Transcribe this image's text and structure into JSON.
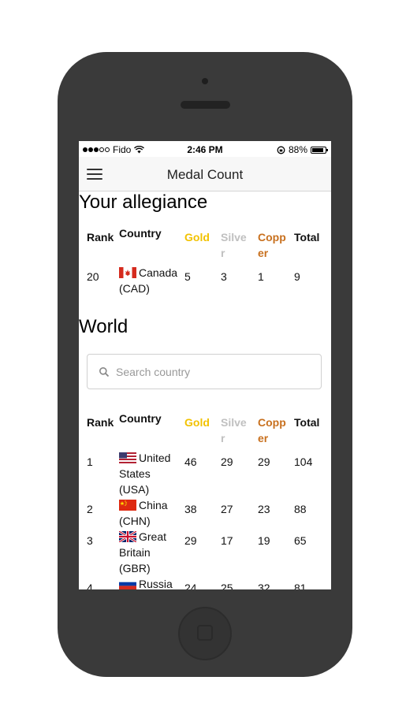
{
  "status": {
    "carrier": "Fido",
    "time": "2:46 PM",
    "battery": "88%",
    "battery_level": 0.88
  },
  "nav": {
    "title": "Medal Count",
    "menu_icon": "hamburger-icon"
  },
  "allegiance": {
    "heading": "Your allegiance",
    "columns": {
      "rank": "Rank",
      "country": "Country",
      "gold": "Gold",
      "silver": "Silver",
      "copper": "Copper",
      "total": "Total"
    },
    "row": {
      "rank": "20",
      "country": "Canada (CAD)",
      "flag": "canada-flag-icon",
      "gold": "5",
      "silver": "3",
      "copper": "1",
      "total": "9"
    }
  },
  "world": {
    "heading": "World",
    "search_placeholder": "Search country",
    "columns": {
      "rank": "Rank",
      "country": "Country",
      "gold": "Gold",
      "silver": "Silver",
      "copper": "Copper",
      "total": "Total"
    },
    "rows": [
      {
        "rank": "1",
        "country": "United States (USA)",
        "flag": "usa-flag-icon",
        "gold": "46",
        "silver": "29",
        "copper": "29",
        "total": "104"
      },
      {
        "rank": "2",
        "country": "China (CHN)",
        "flag": "china-flag-icon",
        "gold": "38",
        "silver": "27",
        "copper": "23",
        "total": "88"
      },
      {
        "rank": "3",
        "country": "Great Britain (GBR)",
        "flag": "uk-flag-icon",
        "gold": "29",
        "silver": "17",
        "copper": "19",
        "total": "65"
      },
      {
        "rank": "4",
        "country": "Russia",
        "flag": "russia-flag-icon",
        "gold": "24",
        "silver": "25",
        "copper": "32",
        "total": "81"
      }
    ]
  },
  "colors": {
    "gold": "#f2c200",
    "silver": "#c0c0c0",
    "copper": "#c8701e",
    "phone_body": "#3a3a3a"
  }
}
